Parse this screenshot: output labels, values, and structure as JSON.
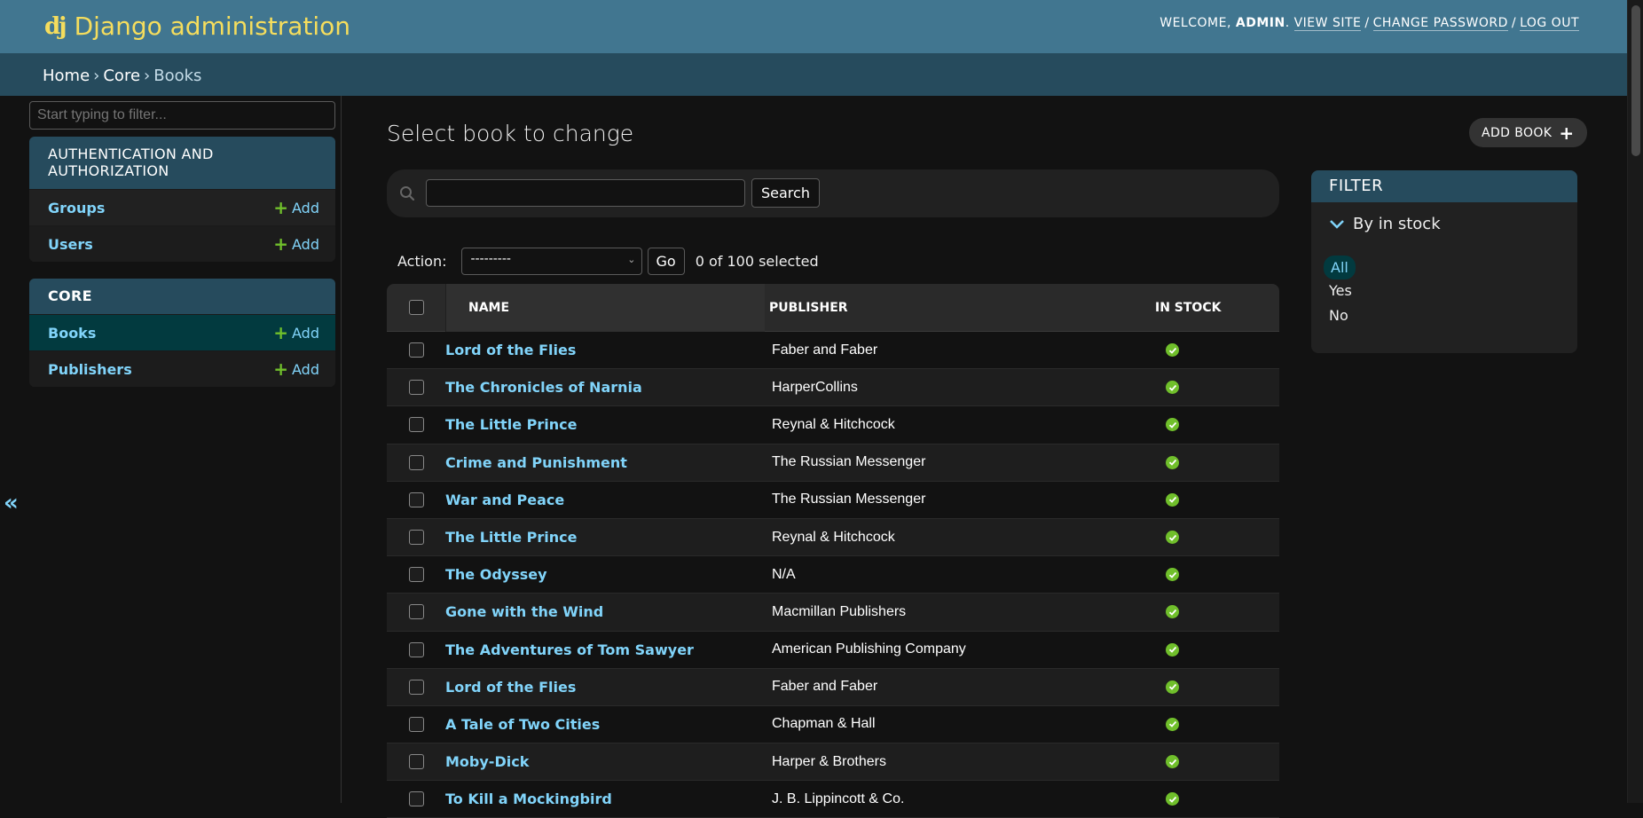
{
  "header": {
    "logo": "dj",
    "title": "Django administration",
    "welcome": "Welcome,",
    "username": "admin",
    "view_site": "View site",
    "change_password": "Change password",
    "log_out": "Log out"
  },
  "breadcrumbs": {
    "home": "Home",
    "app": "Core",
    "current": "Books",
    "separator": "›"
  },
  "sidebar": {
    "filter_placeholder": "Start typing to filter...",
    "toggle": "«",
    "modules": [
      {
        "caption": "Authentication and Authorization",
        "items": [
          {
            "label": "Groups",
            "add": "Add"
          },
          {
            "label": "Users",
            "add": "Add"
          }
        ]
      },
      {
        "caption": "Core",
        "items": [
          {
            "label": "Books",
            "add": "Add"
          },
          {
            "label": "Publishers",
            "add": "Add"
          }
        ]
      }
    ]
  },
  "main": {
    "title": "Select book to change",
    "add_button": "Add book",
    "search_button": "Search",
    "search_value": "",
    "action_label": "Action:",
    "action_selected": "---------",
    "go_button": "Go",
    "selected_count": "0 of 100 selected",
    "columns": [
      "Name",
      "Publisher",
      "In stock"
    ],
    "rows": [
      {
        "name": "Lord of the Flies",
        "publisher": "Faber and Faber",
        "in_stock": true
      },
      {
        "name": "The Chronicles of Narnia",
        "publisher": "HarperCollins",
        "in_stock": true
      },
      {
        "name": "The Little Prince",
        "publisher": "Reynal & Hitchcock",
        "in_stock": true
      },
      {
        "name": "Crime and Punishment",
        "publisher": "The Russian Messenger",
        "in_stock": true
      },
      {
        "name": "War and Peace",
        "publisher": "The Russian Messenger",
        "in_stock": true
      },
      {
        "name": "The Little Prince",
        "publisher": "Reynal & Hitchcock",
        "in_stock": true
      },
      {
        "name": "The Odyssey",
        "publisher": "N/A",
        "in_stock": true
      },
      {
        "name": "Gone with the Wind",
        "publisher": "Macmillan Publishers",
        "in_stock": true
      },
      {
        "name": "The Adventures of Tom Sawyer",
        "publisher": "American Publishing Company",
        "in_stock": true
      },
      {
        "name": "Lord of the Flies",
        "publisher": "Faber and Faber",
        "in_stock": true
      },
      {
        "name": "A Tale of Two Cities",
        "publisher": "Chapman & Hall",
        "in_stock": true
      },
      {
        "name": "Moby-Dick",
        "publisher": "Harper & Brothers",
        "in_stock": true
      },
      {
        "name": "To Kill a Mockingbird",
        "publisher": "J. B. Lippincott & Co.",
        "in_stock": true
      }
    ]
  },
  "filter": {
    "title": "Filter",
    "group": "By in stock",
    "options": [
      {
        "label": "All",
        "selected": true
      },
      {
        "label": "Yes",
        "selected": false
      },
      {
        "label": "No",
        "selected": false
      }
    ]
  },
  "colors": {
    "header_bg": "#417690",
    "breadcrumbs_bg": "#264b5d",
    "brand_yellow": "#f5dd5d",
    "link_blue": "#81d4fa",
    "add_green": "#70bf2b",
    "selected_bg": "#023a3f"
  },
  "icons": {
    "search": "search-icon",
    "add": "plus-icon",
    "in_stock": "yes-icon",
    "filter_group": "chevron-down-icon",
    "collapse_sidebar": "double-chevron-left-icon"
  }
}
